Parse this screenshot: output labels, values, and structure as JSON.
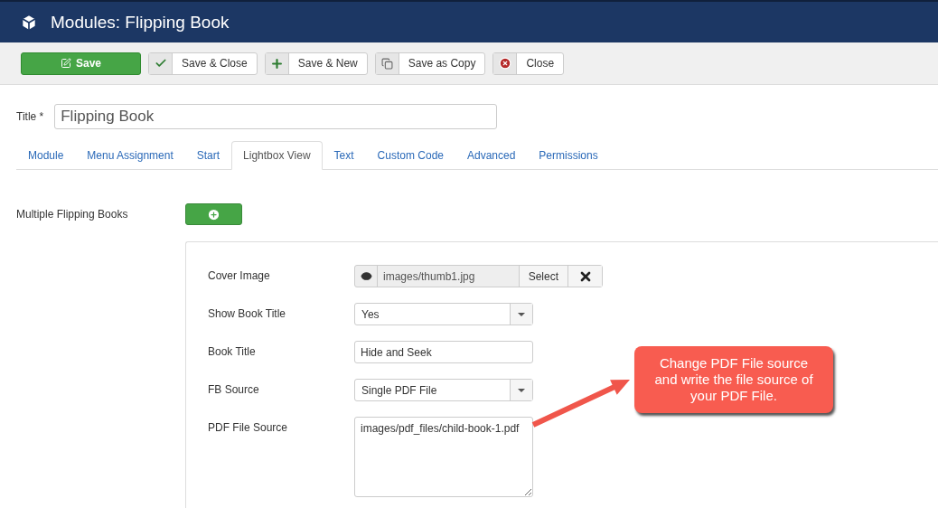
{
  "header": {
    "title": "Modules: Flipping Book"
  },
  "toolbar": [
    {
      "label": "Save",
      "kind": "save"
    },
    {
      "label": "Save & Close",
      "kind": "saveclose"
    },
    {
      "label": "Save & New",
      "kind": "savenew"
    },
    {
      "label": "Save as Copy",
      "kind": "savecopy"
    },
    {
      "label": "Close",
      "kind": "close"
    }
  ],
  "title_field": {
    "label": "Title *",
    "value": "Flipping Book"
  },
  "tabs": [
    {
      "label": "Module",
      "selected": false
    },
    {
      "label": "Menu Assignment",
      "selected": false
    },
    {
      "label": "Start",
      "selected": false
    },
    {
      "label": "Lightbox View",
      "selected": true
    },
    {
      "label": "Text",
      "selected": false
    },
    {
      "label": "Custom Code",
      "selected": false
    },
    {
      "label": "Advanced",
      "selected": false
    },
    {
      "label": "Permissions",
      "selected": false
    }
  ],
  "multiple": {
    "label": "Multiple Flipping Books"
  },
  "fields": [
    {
      "kind": "media",
      "label": "Cover Image",
      "value": "images/thumb1.jpg",
      "button": "Select"
    },
    {
      "kind": "select",
      "label": "Show Book Title",
      "value": "Yes"
    },
    {
      "kind": "text",
      "label": "Book Title",
      "value": "Hide and Seek"
    },
    {
      "kind": "select",
      "label": "FB Source",
      "value": "Single PDF File"
    },
    {
      "kind": "textarea",
      "label": "PDF File Source",
      "value": "images/pdf_files/child-book-1.pdf"
    }
  ],
  "callout": {
    "text": "Change PDF File source and write the file source of your PDF File."
  }
}
